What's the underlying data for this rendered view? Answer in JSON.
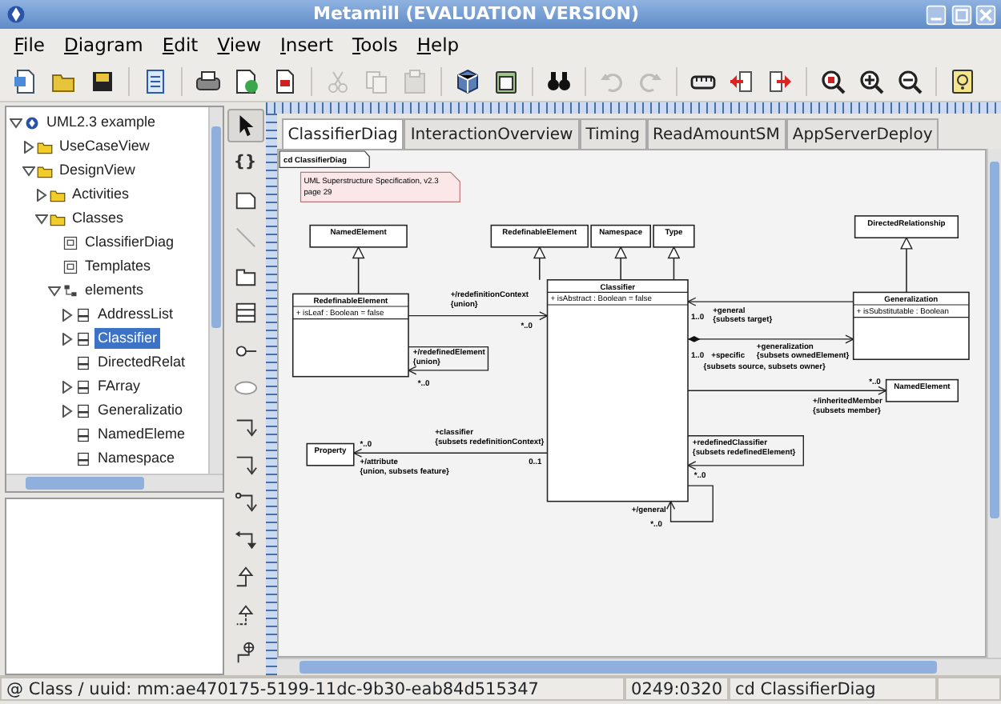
{
  "window": {
    "title": "Metamill (EVALUATION VERSION)"
  },
  "menu": [
    "File",
    "Diagram",
    "Edit",
    "View",
    "Insert",
    "Tools",
    "Help"
  ],
  "toolbar": [
    {
      "kind": "new-document",
      "disabled": false
    },
    {
      "kind": "open",
      "disabled": false
    },
    {
      "kind": "save",
      "disabled": false
    },
    {
      "kind": "separator"
    },
    {
      "kind": "properties",
      "disabled": false
    },
    {
      "kind": "separator"
    },
    {
      "kind": "print",
      "disabled": false
    },
    {
      "kind": "export-image",
      "disabled": false
    },
    {
      "kind": "pdf",
      "disabled": false
    },
    {
      "kind": "separator"
    },
    {
      "kind": "cut",
      "disabled": true
    },
    {
      "kind": "copy",
      "disabled": true
    },
    {
      "kind": "paste",
      "disabled": true
    },
    {
      "kind": "separator"
    },
    {
      "kind": "cube",
      "disabled": false
    },
    {
      "kind": "clipboard",
      "disabled": false
    },
    {
      "kind": "separator"
    },
    {
      "kind": "find",
      "disabled": false
    },
    {
      "kind": "separator"
    },
    {
      "kind": "undo",
      "disabled": true
    },
    {
      "kind": "redo",
      "disabled": true
    },
    {
      "kind": "separator"
    },
    {
      "kind": "ruler",
      "disabled": false
    },
    {
      "kind": "import",
      "disabled": false
    },
    {
      "kind": "export",
      "disabled": false
    },
    {
      "kind": "separator"
    },
    {
      "kind": "zoom-fit",
      "disabled": false
    },
    {
      "kind": "zoom-in",
      "disabled": false
    },
    {
      "kind": "zoom-out",
      "disabled": false
    },
    {
      "kind": "separator"
    },
    {
      "kind": "help",
      "disabled": false
    }
  ],
  "tree": [
    {
      "label": "UML2.3 example",
      "kind": "model",
      "expanded": true,
      "selected": false,
      "children": [
        {
          "label": "UseCaseView",
          "kind": "folder",
          "expanded": false,
          "selected": false
        },
        {
          "label": "DesignView",
          "kind": "folder",
          "expanded": true,
          "selected": false,
          "children": [
            {
              "label": "Activities",
              "kind": "folder",
              "expanded": false,
              "selected": false
            },
            {
              "label": "Classes",
              "kind": "folder",
              "expanded": true,
              "selected": false,
              "children": [
                {
                  "label": "ClassifierDiag",
                  "kind": "diagram",
                  "selected": false
                },
                {
                  "label": "Templates",
                  "kind": "diagram",
                  "selected": false
                },
                {
                  "label": "elements",
                  "kind": "package",
                  "expanded": true,
                  "selected": false,
                  "children": [
                    {
                      "label": "AddressList",
                      "kind": "class",
                      "expanded": false,
                      "selected": false
                    },
                    {
                      "label": "Classifier",
                      "kind": "class",
                      "expanded": false,
                      "selected": true
                    },
                    {
                      "label": "DirectedRelat",
                      "kind": "class",
                      "selected": false
                    },
                    {
                      "label": "FArray",
                      "kind": "class",
                      "expanded": false,
                      "selected": false
                    },
                    {
                      "label": "Generalizatio",
                      "kind": "class",
                      "expanded": false,
                      "selected": false
                    },
                    {
                      "label": "NamedEleme",
                      "kind": "class",
                      "selected": false
                    },
                    {
                      "label": "Namespace",
                      "kind": "class",
                      "selected": false
                    }
                  ]
                }
              ]
            }
          ]
        }
      ]
    }
  ],
  "palette": [
    {
      "kind": "pointer",
      "selected": true
    },
    {
      "kind": "constraint",
      "label": "{}",
      "selected": false
    },
    {
      "kind": "note",
      "selected": false
    },
    {
      "kind": "line",
      "selected": false
    },
    {
      "kind": "package",
      "selected": false
    },
    {
      "kind": "class",
      "selected": false
    },
    {
      "kind": "interface",
      "selected": false
    },
    {
      "kind": "ellipse",
      "selected": false
    },
    {
      "kind": "step-down",
      "selected": false
    },
    {
      "kind": "step-right",
      "selected": false
    },
    {
      "kind": "step-dot",
      "selected": false
    },
    {
      "kind": "step-arrow",
      "selected": false
    },
    {
      "kind": "generalization",
      "selected": false
    },
    {
      "kind": "realization",
      "selected": false
    },
    {
      "kind": "anchor",
      "selected": false
    }
  ],
  "tabs": [
    {
      "label": "ClassifierDiag",
      "selected": true
    },
    {
      "label": "InteractionOverview",
      "selected": false
    },
    {
      "label": "Timing",
      "selected": false
    },
    {
      "label": "ReadAmountSM",
      "selected": false
    },
    {
      "label": "AppServerDeploy",
      "selected": false
    }
  ],
  "diagram": {
    "frame_label": "cd ClassifierDiag",
    "note": [
      "UML Superstructure Specification, v2.3",
      "page 29"
    ],
    "classes": [
      {
        "name": "NamedElement"
      },
      {
        "name": "RedefinableElement"
      },
      {
        "name": "Namespace"
      },
      {
        "name": "Type"
      },
      {
        "name": "DirectedRelationship"
      },
      {
        "name": "RedefinableElement",
        "attributes": [
          "+ isLeaf : Boolean = false"
        ]
      },
      {
        "name": "Classifier",
        "attributes": [
          "+ isAbstract : Boolean = false"
        ]
      },
      {
        "name": "Generalization",
        "attributes": [
          "+ isSubstitutable : Boolean"
        ]
      },
      {
        "name": "NamedElement"
      },
      {
        "name": "Property"
      }
    ],
    "labels": [
      "+/redefinitionContext",
      "{union}",
      "*..0",
      "+/redefinedElement",
      "{union}",
      "*..0",
      "1..0",
      "+general",
      "{subsets target}",
      "+generalization",
      "1..0",
      "+specific",
      "{subsets ownedElement}",
      "{subsets source, subsets owner}",
      "*..0",
      "+/inheritedMember",
      "{subsets member}",
      "*..0",
      "0..1",
      "+/attribute",
      "{union, subsets feature}",
      "+classifier",
      "{subsets redefinitionContext}",
      "+redefinedClassifier",
      "{subsets redefinedElement}",
      "*..0",
      "+/general",
      "*..0"
    ]
  },
  "status_bar": {
    "element": "@ Class / uuid: mm:ae470175-5199-11dc-9b30-eab84d515347",
    "position": "0249:0320",
    "diagram": "cd ClassifierDiag"
  }
}
